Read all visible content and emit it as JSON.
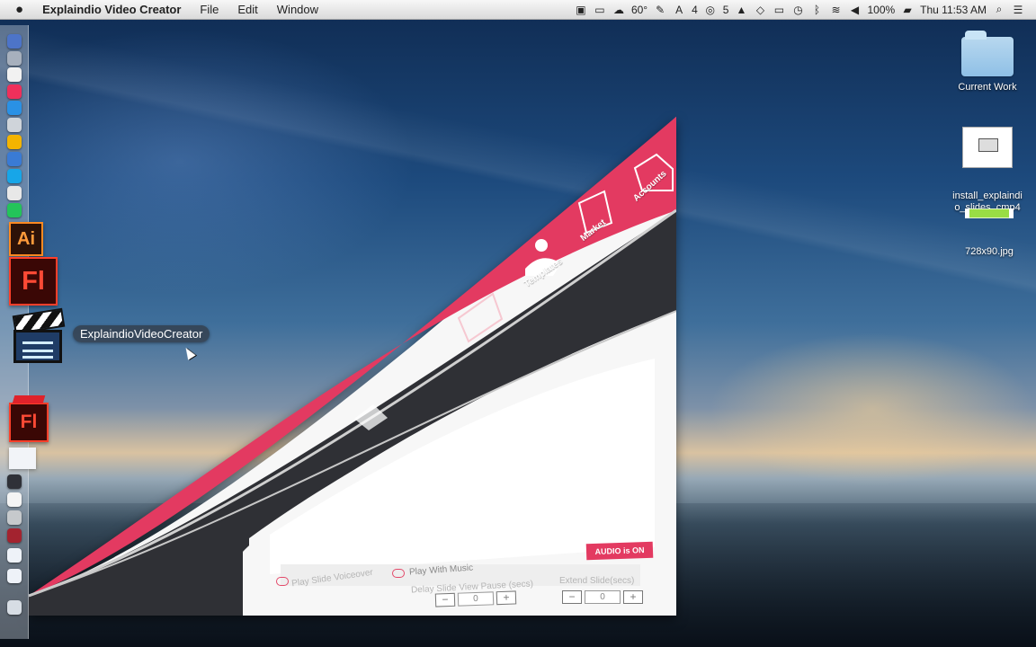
{
  "menubar": {
    "apple_icon": "apple-icon",
    "app_name": "Explaindio Video Creator",
    "items": [
      "File",
      "Edit",
      "Window"
    ],
    "status": {
      "weather": "60°",
      "adobe_count": "4",
      "cloud_count": "5",
      "battery": "100%",
      "time": "Thu 11:53 AM"
    }
  },
  "desktop": {
    "items": [
      {
        "label": "Current Work",
        "icon": "folder-icon"
      },
      {
        "label": "install_explaindi\no_slides_cmp4",
        "icon": "document-icon"
      },
      {
        "label": "728x90.jpg",
        "icon": "image-file-icon"
      }
    ]
  },
  "dock": {
    "tooltip": "ExplaindioVideoCreator",
    "large_icons": [
      {
        "label": "Ai",
        "icon": "illustrator-icon"
      },
      {
        "label": "Fl",
        "icon": "flash-icon"
      },
      {
        "label": "Fl",
        "icon": "flash-small-icon"
      }
    ]
  },
  "app_window": {
    "nav_items": [
      "Accounts",
      "Market",
      "Templates"
    ],
    "controls": {
      "play_slide_voiceover": "Play Slide Voiceover",
      "play_with_music": "Play With Music",
      "delay_label": "Delay Slide View Pause (secs)",
      "extend_label": "Extend Slide(secs)",
      "delay_value": "0",
      "extend_value": "0",
      "audio_button": "AUDIO is ON"
    },
    "colors": {
      "accent": "#e33a61",
      "dark": "#2f3035",
      "panel": "#ffffff"
    }
  }
}
